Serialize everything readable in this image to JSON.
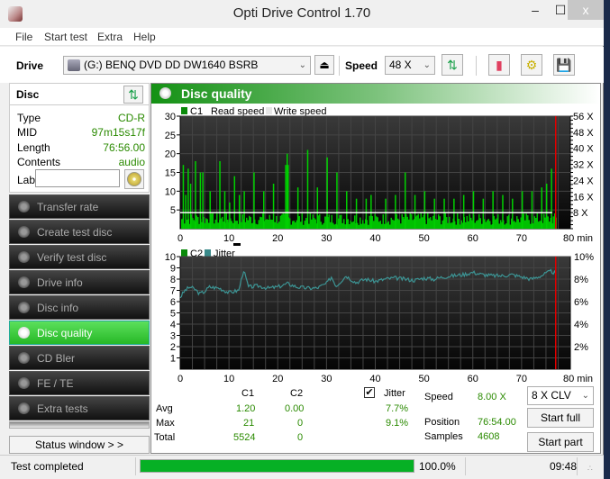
{
  "window": {
    "title": "Opti Drive Control 1.70",
    "min": "–",
    "max": "☐",
    "close": "x"
  },
  "menu": [
    "File",
    "Start test",
    "Extra",
    "Help"
  ],
  "toolbar": {
    "drive_label": "Drive",
    "drive_value": "(G:)  BENQ DVD DD DW1640 BSRB",
    "speed_label": "Speed",
    "speed_value": "48 X",
    "icons": [
      "eject-icon",
      "refresh-icon",
      "erase-icon",
      "settings-icon",
      "save-icon"
    ]
  },
  "disc": {
    "header": "Disc",
    "rows": [
      {
        "key": "Type",
        "value": "CD-R"
      },
      {
        "key": "MID",
        "value": "97m15s17f"
      },
      {
        "key": "Length",
        "value": "76:56.00"
      },
      {
        "key": "Contents",
        "value": "audio"
      }
    ],
    "label_key": "Label",
    "label_value": ""
  },
  "nav": [
    {
      "label": "Transfer rate",
      "active": false
    },
    {
      "label": "Create test disc",
      "active": false
    },
    {
      "label": "Verify test disc",
      "active": false
    },
    {
      "label": "Drive info",
      "active": false
    },
    {
      "label": "Disc info",
      "active": false
    },
    {
      "label": "Disc quality",
      "active": true
    },
    {
      "label": "CD Bler",
      "active": false
    },
    {
      "label": "FE / TE",
      "active": false
    },
    {
      "label": "Extra tests",
      "active": false
    }
  ],
  "status_window_label": "Status window > >",
  "panel_title": "Disc quality",
  "chart_data": [
    {
      "type": "bar",
      "title": "C1 / Read speed",
      "legend": [
        "C1",
        "Read speed",
        "Write speed"
      ],
      "xlabel": "min",
      "x_ticks": [
        "0",
        "10",
        "20",
        "30",
        "40",
        "50",
        "60",
        "70",
        "80 min"
      ],
      "xlim": [
        0,
        80
      ],
      "ylim": [
        0,
        30
      ],
      "y_ticks": [
        "5",
        "10",
        "15",
        "20",
        "25",
        "30"
      ],
      "y2_ticks": [
        "8 X",
        "16 X",
        "24 X",
        "32 X",
        "40 X",
        "48 X",
        "56 X"
      ],
      "y2lim": [
        0,
        56
      ],
      "read_speed_x": 8,
      "end_marker_min": 77,
      "c1_peaks": [
        [
          0.5,
          17
        ],
        [
          1,
          9
        ],
        [
          1.5,
          16
        ],
        [
          2,
          12
        ],
        [
          3,
          18
        ],
        [
          4,
          15
        ],
        [
          4.5,
          15
        ],
        [
          6,
          10
        ],
        [
          8,
          18
        ],
        [
          9,
          10
        ],
        [
          10,
          7
        ],
        [
          11,
          14
        ],
        [
          12,
          9
        ],
        [
          13,
          10
        ],
        [
          15,
          15
        ],
        [
          17,
          10
        ],
        [
          19,
          12
        ],
        [
          21.5,
          17
        ],
        [
          21.8,
          20
        ],
        [
          22,
          17
        ],
        [
          24,
          11
        ],
        [
          26,
          21
        ],
        [
          28,
          11
        ],
        [
          30,
          19
        ],
        [
          32,
          15
        ],
        [
          34,
          10
        ],
        [
          36,
          8
        ],
        [
          38,
          8
        ],
        [
          39,
          9
        ],
        [
          42,
          8
        ],
        [
          44,
          9
        ],
        [
          46,
          15
        ],
        [
          48,
          9
        ],
        [
          50,
          10
        ],
        [
          52,
          8
        ],
        [
          54,
          8
        ],
        [
          56,
          8
        ],
        [
          58,
          9
        ],
        [
          60,
          10
        ],
        [
          62,
          8
        ],
        [
          64,
          10
        ],
        [
          66,
          9
        ],
        [
          68,
          8
        ],
        [
          70,
          10
        ],
        [
          72,
          10
        ],
        [
          74,
          11
        ],
        [
          75,
          12
        ],
        [
          76,
          16
        ]
      ]
    },
    {
      "type": "line",
      "title": "C2 / Jitter",
      "legend": [
        "C2",
        "Jitter"
      ],
      "xlabel": "min",
      "x_ticks": [
        "0",
        "10",
        "20",
        "30",
        "40",
        "50",
        "60",
        "70",
        "80 min"
      ],
      "xlim": [
        0,
        80
      ],
      "ylim": [
        0,
        10
      ],
      "y_ticks": [
        "1",
        "2",
        "3",
        "4",
        "5",
        "6",
        "7",
        "8",
        "9",
        "10"
      ],
      "y2_ticks": [
        "2%",
        "4%",
        "6%",
        "8%",
        "10%"
      ],
      "end_marker_min": 77,
      "jitter": [
        [
          0,
          6.4
        ],
        [
          1,
          7.0
        ],
        [
          2,
          7.3
        ],
        [
          3,
          7.1
        ],
        [
          4,
          6.7
        ],
        [
          5,
          6.9
        ],
        [
          6,
          7.3
        ],
        [
          8,
          7.2
        ],
        [
          10,
          6.8
        ],
        [
          12,
          7.0
        ],
        [
          13,
          8.8
        ],
        [
          14,
          7.3
        ],
        [
          16,
          7.4
        ],
        [
          18,
          7.2
        ],
        [
          20,
          7.3
        ],
        [
          22,
          7.6
        ],
        [
          24,
          7.3
        ],
        [
          26,
          7.2
        ],
        [
          28,
          7.2
        ],
        [
          30,
          7.6
        ],
        [
          31,
          8.2
        ],
        [
          32,
          7.4
        ],
        [
          34,
          8.3
        ],
        [
          36,
          7.7
        ],
        [
          38,
          8.0
        ],
        [
          40,
          7.8
        ],
        [
          42,
          8.0
        ],
        [
          44,
          8.1
        ],
        [
          46,
          8.0
        ],
        [
          48,
          7.9
        ],
        [
          50,
          8.1
        ],
        [
          52,
          8.0
        ],
        [
          54,
          8.2
        ],
        [
          56,
          8.3
        ],
        [
          58,
          8.4
        ],
        [
          60,
          8.6
        ],
        [
          62,
          8.4
        ],
        [
          64,
          8.3
        ],
        [
          66,
          8.3
        ],
        [
          68,
          8.4
        ],
        [
          70,
          8.2
        ],
        [
          72,
          8.0
        ],
        [
          74,
          8.3
        ],
        [
          76,
          8.7
        ],
        [
          77,
          8.5
        ]
      ]
    }
  ],
  "stats": {
    "col_c1": "C1",
    "col_c2": "C2",
    "jitter_label": "Jitter",
    "jitter_checked": true,
    "rows": [
      {
        "label": "Avg",
        "c1": "1.20",
        "c2": "0.00",
        "jitter": "7.7%"
      },
      {
        "label": "Max",
        "c1": "21",
        "c2": "0",
        "jitter": "9.1%"
      },
      {
        "label": "Total",
        "c1": "5524",
        "c2": "0",
        "jitter": ""
      }
    ],
    "speed_label": "Speed",
    "speed_value": "8.00 X",
    "position_label": "Position",
    "position_value": "76:54.00",
    "samples_label": "Samples",
    "samples_value": "4608",
    "speed_mode": "8 X CLV",
    "start_full": "Start full",
    "start_part": "Start part"
  },
  "statusbar": {
    "text": "Test completed",
    "progress_percent": 100,
    "progress_text": "100.0%",
    "time": "09:48"
  }
}
